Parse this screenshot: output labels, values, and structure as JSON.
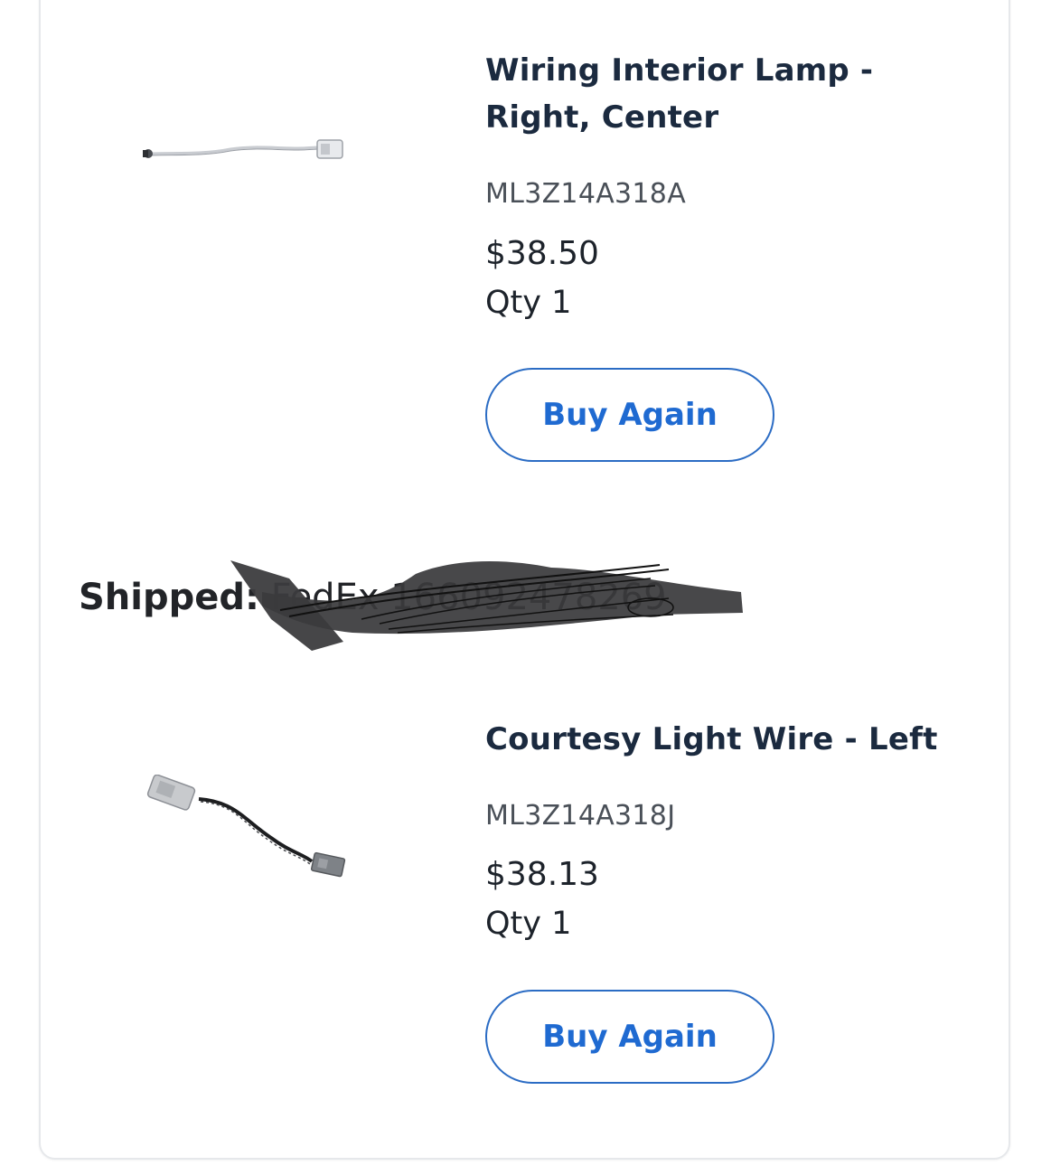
{
  "items": [
    {
      "title_line1": "Wiring Interior Lamp -",
      "title_line2": "Right, Center",
      "part_number": "ML3Z14A318A",
      "price": "$38.50",
      "qty": "Qty 1",
      "button_label": "Buy Again",
      "image": "wiring-harness-thin-image"
    },
    {
      "title": "Courtesy Light Wire - Left",
      "part_number": "ML3Z14A318J",
      "price": "$38.13",
      "qty": "Qty 1",
      "button_label": "Buy Again",
      "image": "courtesy-light-wire-image"
    }
  ],
  "shipment": {
    "label": "Shipped:",
    "value": "FedEx 166092478269"
  },
  "colors": {
    "accent": "#1f6ad1",
    "title_text": "#1b2a3f",
    "card_border": "#e6e8eb",
    "redaction": "#3a3a3a"
  }
}
